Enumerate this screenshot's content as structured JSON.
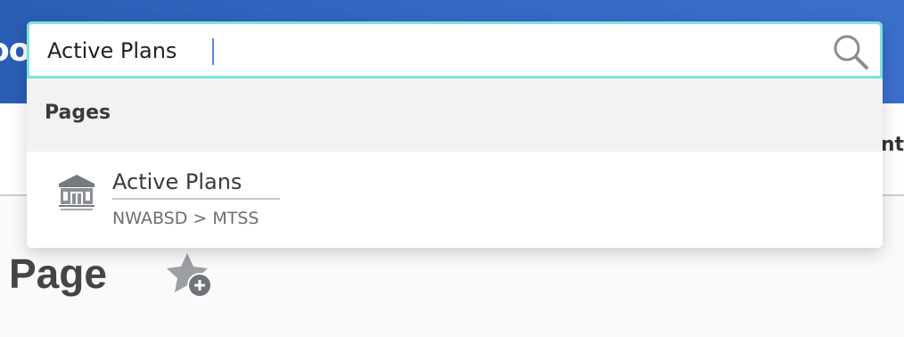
{
  "header": {
    "brand_fragment": "oo"
  },
  "nav": {
    "fragment": "nt"
  },
  "page": {
    "title": "Page"
  },
  "search": {
    "value": "Active Plans",
    "placeholder": "",
    "icon": "search-icon"
  },
  "results": {
    "group_label": "Pages",
    "items": [
      {
        "title": "Active Plans",
        "path": "NWABSD > MTSS",
        "icon": "building-icon"
      }
    ]
  },
  "colors": {
    "header_blue": "#2f63bd",
    "focus_border": "#7fe2da",
    "caret": "#5b87e6"
  }
}
